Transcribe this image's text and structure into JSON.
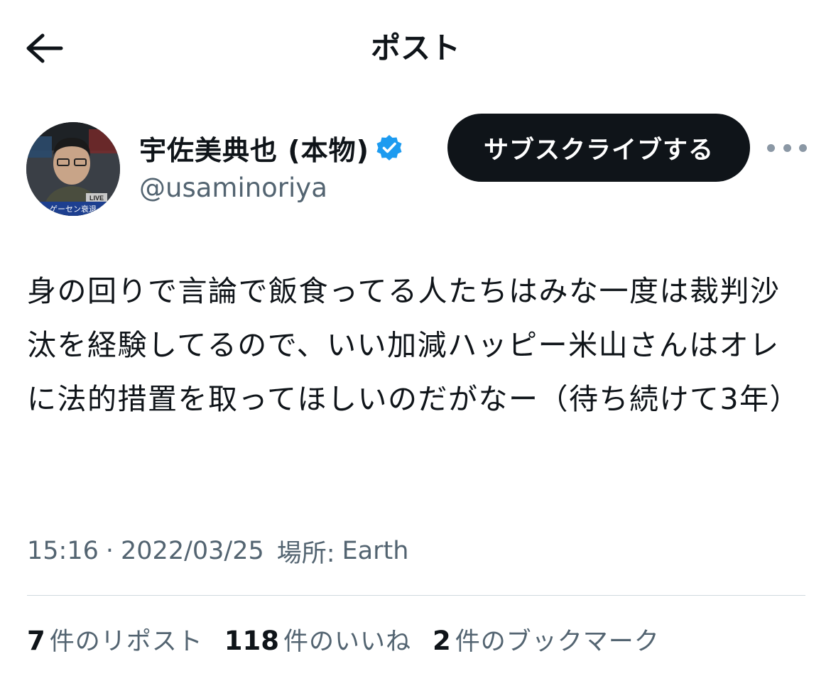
{
  "header": {
    "title": "ポスト",
    "back_icon": "arrow-left-icon"
  },
  "author": {
    "display_name": "宇佐美典也 (本物)",
    "handle": "@usaminoriya",
    "verified_icon": "verified-badge-icon",
    "verified_color": "#1d9bf0",
    "avatar_overlay": {
      "badge": "LIVE",
      "caption": "ゲーセン衰退"
    }
  },
  "actions": {
    "subscribe_label": "サブスクライブする",
    "more_icon": "more-horizontal-icon"
  },
  "tweet": {
    "text": "身の回りで言論で飯食ってる人たちはみな一度は裁判沙汰を経験してるので、いい加減ハッピー米山さんはオレに法的措置を取ってほしいのだがなー（待ち続けて3年）"
  },
  "meta": {
    "time": "15:16",
    "separator": "·",
    "date": "2022/03/25",
    "location_label": "場所:",
    "location_value": "Earth"
  },
  "stats": [
    {
      "count": "7",
      "label": "件のリポスト"
    },
    {
      "count": "118",
      "label": "件のいいね"
    },
    {
      "count": "2",
      "label": "件のブックマーク"
    }
  ],
  "colors": {
    "text_primary": "#0f1419",
    "text_secondary": "#536471",
    "button_bg": "#0f1419",
    "divider": "#cfd9de"
  }
}
